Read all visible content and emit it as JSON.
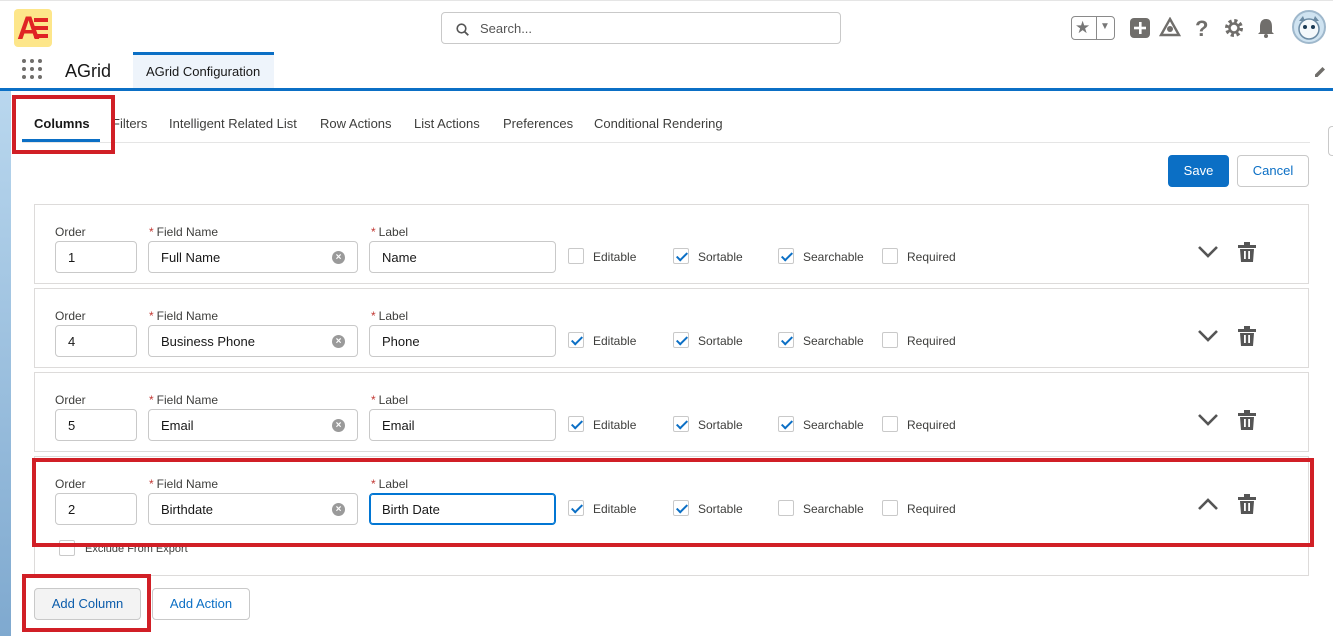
{
  "header": {
    "search_placeholder": "Search..."
  },
  "nav": {
    "app_name": "AGrid",
    "tab_label": "AGrid Configuration"
  },
  "tabs": [
    "Columns",
    "Filters",
    "Intelligent Related List",
    "Row Actions",
    "List Actions",
    "Preferences",
    "Conditional Rendering"
  ],
  "actions": {
    "save": "Save",
    "cancel": "Cancel"
  },
  "labels": {
    "order": "Order",
    "field_name": "Field Name",
    "label": "Label",
    "editable": "Editable",
    "sortable": "Sortable",
    "searchable": "Searchable",
    "required": "Required",
    "exclude_export": "Exclude From Export"
  },
  "columns": [
    {
      "order": "1",
      "field_name": "Full Name",
      "label": "Name",
      "editable": false,
      "sortable": true,
      "searchable": true,
      "required": false,
      "expanded": false
    },
    {
      "order": "4",
      "field_name": "Business Phone",
      "label": "Phone",
      "editable": true,
      "sortable": true,
      "searchable": true,
      "required": false,
      "expanded": false
    },
    {
      "order": "5",
      "field_name": "Email",
      "label": "Email",
      "editable": true,
      "sortable": true,
      "searchable": true,
      "required": false,
      "expanded": false
    },
    {
      "order": "2",
      "field_name": "Birthdate",
      "label": "Birth Date",
      "editable": true,
      "sortable": true,
      "searchable": false,
      "required": false,
      "expanded": true,
      "exclude_from_export": false
    }
  ],
  "footer": {
    "add_column": "Add Column",
    "add_action": "Add Action"
  },
  "colors": {
    "brand": "#0b6fc5",
    "highlight": "#d11f26"
  }
}
